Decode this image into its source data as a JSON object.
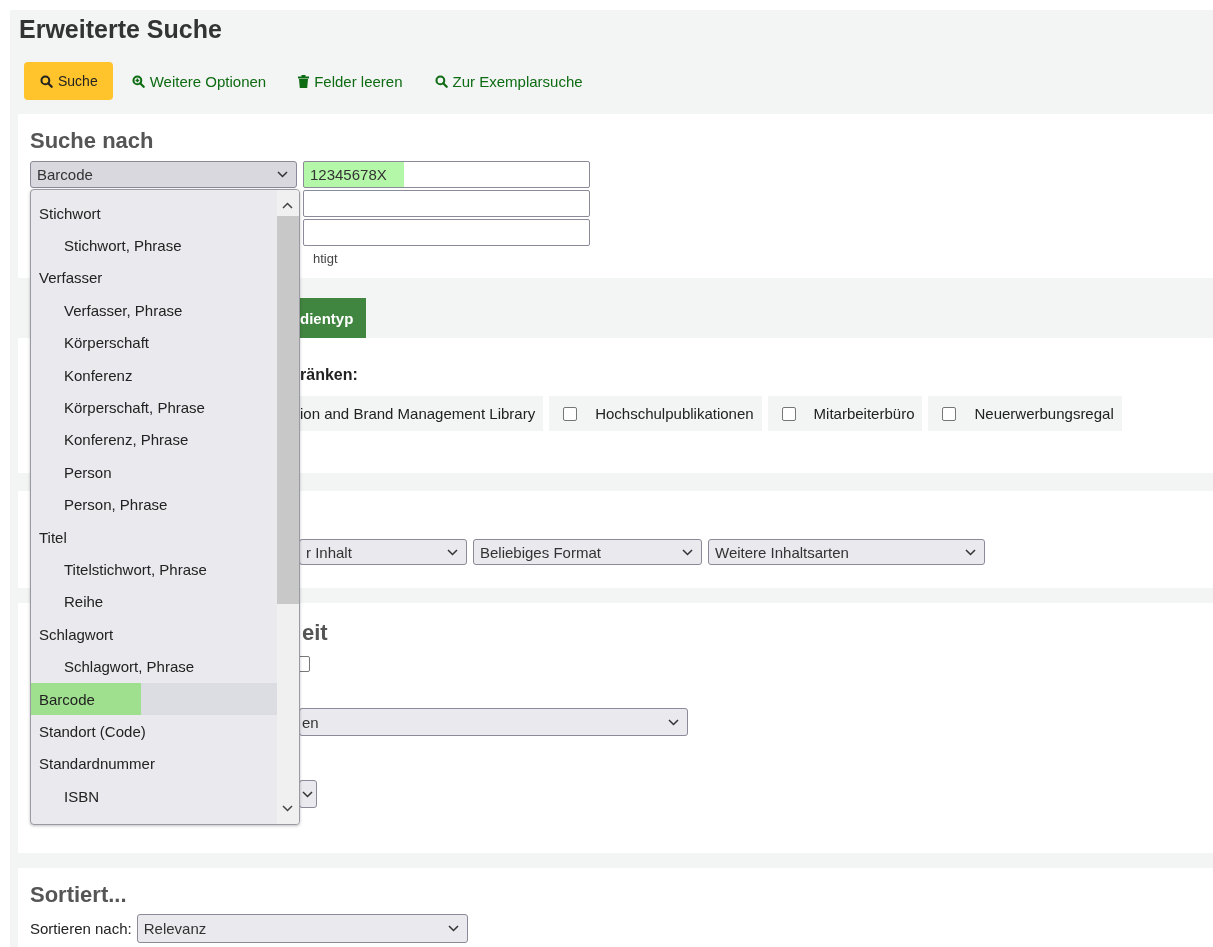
{
  "page_title": "Erweiterte Suche",
  "toolbar": [
    {
      "label": "Suche",
      "primary": true
    },
    {
      "label": "Weitere Optionen",
      "primary": false
    },
    {
      "label": "Felder leeren",
      "primary": false
    },
    {
      "label": "Zur Exemplarsuche",
      "primary": false
    }
  ],
  "search_section": {
    "heading": "Suche nach",
    "index_select": {
      "value": "Barcode"
    },
    "terms": [
      {
        "value": "12345678X",
        "highlighted": true
      },
      {
        "highlighted": false
      },
      {
        "highlighted": false
      }
    ],
    "note": "htigt"
  },
  "index_dropdown": {
    "items": [
      {
        "label": "Stichwort",
        "selected": false,
        "highlighted": false,
        "children": [
          {
            "label": "Stichwort, Phrase",
            "selected": false,
            "highlighted": false
          }
        ]
      },
      {
        "label": "Verfasser",
        "selected": false,
        "highlighted": false,
        "children": [
          {
            "label": "Verfasser, Phrase",
            "selected": false,
            "highlighted": false
          },
          {
            "label": "Körperschaft",
            "selected": false,
            "highlighted": false
          },
          {
            "label": "Konferenz",
            "selected": false,
            "highlighted": false
          },
          {
            "label": "Körperschaft, Phrase",
            "selected": false,
            "highlighted": false
          },
          {
            "label": "Konferenz, Phrase",
            "selected": false,
            "highlighted": false
          },
          {
            "label": "Person",
            "selected": false,
            "highlighted": false
          },
          {
            "label": "Person, Phrase",
            "selected": false,
            "highlighted": false
          }
        ]
      },
      {
        "label": "Titel",
        "selected": false,
        "highlighted": false,
        "children": [
          {
            "label": "Titelstichwort, Phrase",
            "selected": false,
            "highlighted": false
          },
          {
            "label": "Reihe",
            "selected": false,
            "highlighted": false
          }
        ]
      },
      {
        "label": "Schlagwort",
        "selected": false,
        "highlighted": false,
        "children": [
          {
            "label": "Schlagwort, Phrase",
            "selected": false,
            "highlighted": false
          }
        ]
      },
      {
        "label": "Barcode",
        "selected": true,
        "highlighted": true
      },
      {
        "label": "Standort (Code)",
        "selected": false,
        "highlighted": false
      },
      {
        "label": "Standardnummer",
        "selected": false,
        "highlighted": false,
        "children": [
          {
            "label": "ISBN",
            "selected": false,
            "highlighted": false
          }
        ]
      }
    ]
  },
  "limit_section": {
    "tabs": [
      {
        "label": "dientyp",
        "selected": true
      }
    ],
    "heading": "ränken:",
    "locations": [
      {
        "label": "ion and Brand Management Library"
      },
      {
        "label": "Hochschulpublikationen",
        "checked": false
      },
      {
        "label": "Mitarbeiterbüro",
        "checked": false
      },
      {
        "label": "Neuerwerbungsregal",
        "checked": false
      }
    ]
  },
  "type_section": {
    "selects": [
      "r Inhalt",
      "Beliebiges Format",
      "Weitere Inhaltsarten"
    ]
  },
  "time_section": {
    "heading": "eit",
    "checkbox": {
      "checked": false
    },
    "select": {
      "value": "en"
    }
  },
  "sort_section": {
    "heading": "Sortiert...",
    "label": "Sortieren nach:",
    "select": {
      "value": "Relevanz"
    }
  }
}
